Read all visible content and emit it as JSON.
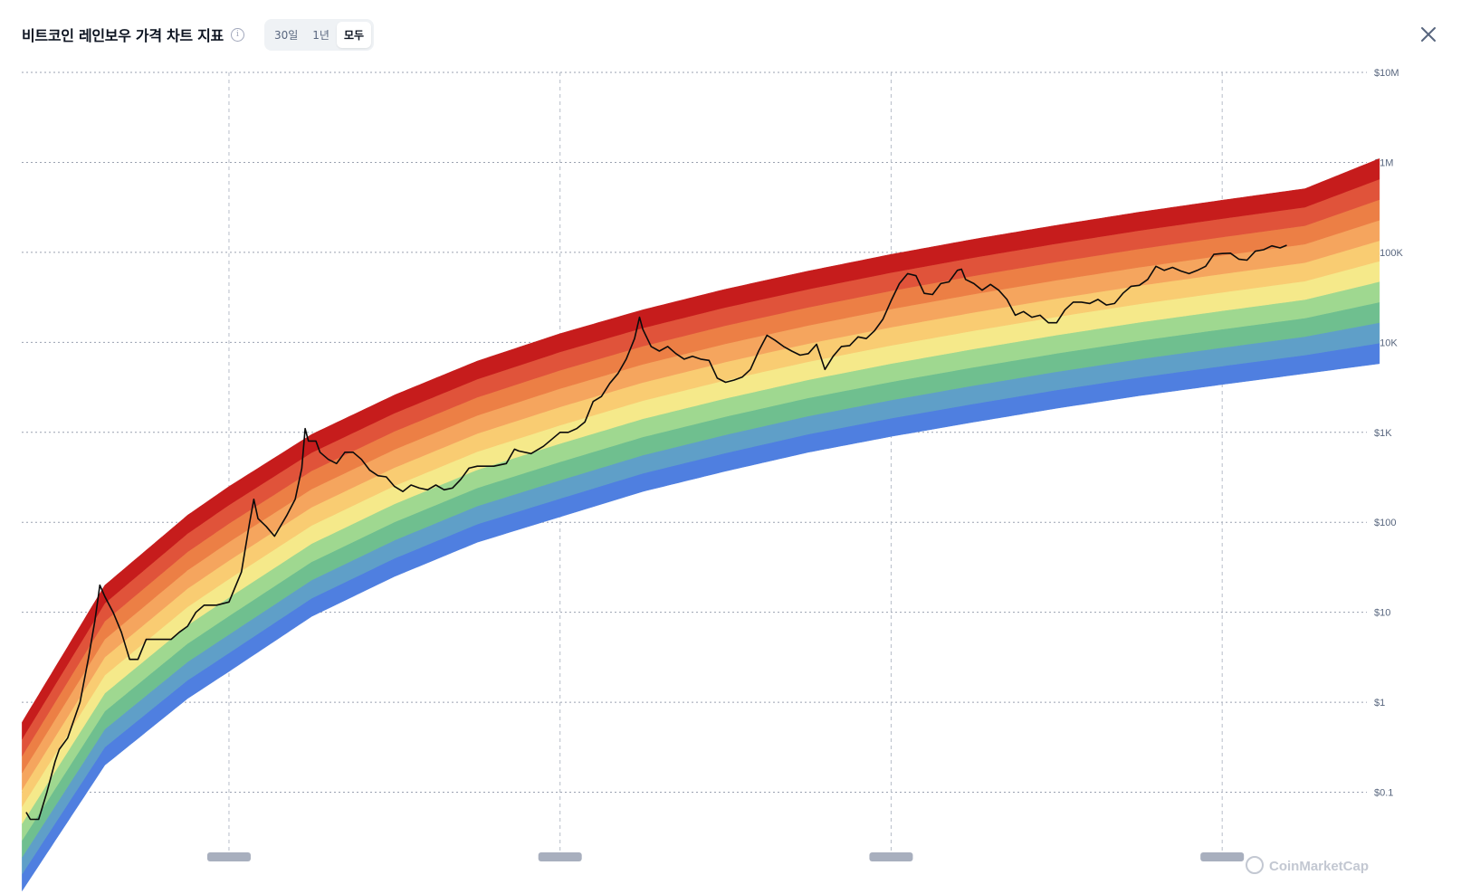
{
  "header": {
    "title": "비트코인 레인보우 가격 차트 지표",
    "info_icon": "info-icon",
    "ranges": [
      "30일",
      "1년",
      "모두"
    ],
    "active_range": "모두",
    "close_icon": "close-icon"
  },
  "watermark": "CoinMarketCap",
  "chart_data": {
    "type": "line",
    "y_scale": "log",
    "ylim": [
      0.01,
      10000000
    ],
    "xlim": [
      "2010-07-01",
      "2026-10-01"
    ],
    "y_ticks": [
      "$10M",
      "$1M",
      "$100K",
      "$10K",
      "$1K",
      "$100",
      "$10",
      "$1",
      "$0.1"
    ],
    "y_tick_values": [
      10000000,
      1000000,
      100000,
      10000,
      1000,
      100,
      10,
      1,
      0.1
    ],
    "x_grid_dates": [
      "2013-01-01",
      "2017-01-01",
      "2021-01-01",
      "2025-01-01"
    ],
    "grid": true,
    "legend": "none",
    "rainbow": {
      "colors": [
        "#4f7fe0",
        "#5f9fc8",
        "#6fbf8f",
        "#9fd890",
        "#f5e98a",
        "#f9cc72",
        "#f5a55e",
        "#ec7f45",
        "#e0533a",
        "#c61c1c"
      ],
      "bottom_band": [
        [
          2010.5,
          0.008
        ],
        [
          2011.5,
          0.2
        ],
        [
          2012.5,
          1.1
        ],
        [
          2013.0,
          2.2
        ],
        [
          2014.0,
          9
        ],
        [
          2015.0,
          25
        ],
        [
          2016.0,
          60
        ],
        [
          2017.0,
          115
        ],
        [
          2018.0,
          220
        ],
        [
          2019.0,
          370
        ],
        [
          2020.0,
          600
        ],
        [
          2021.0,
          900
        ],
        [
          2022.0,
          1300
        ],
        [
          2023.0,
          1850
        ],
        [
          2024.0,
          2550
        ],
        [
          2025.0,
          3400
        ],
        [
          2026.0,
          4500
        ],
        [
          2026.9,
          5800
        ]
      ],
      "top_band": [
        [
          2010.5,
          0.6
        ],
        [
          2011.5,
          20
        ],
        [
          2012.5,
          120
        ],
        [
          2013.0,
          250
        ],
        [
          2014.0,
          950
        ],
        [
          2015.0,
          2600
        ],
        [
          2016.0,
          6200
        ],
        [
          2017.0,
          12500
        ],
        [
          2018.0,
          23000
        ],
        [
          2019.0,
          39000
        ],
        [
          2020.0,
          62000
        ],
        [
          2021.0,
          95000
        ],
        [
          2022.0,
          140000
        ],
        [
          2023.0,
          200000
        ],
        [
          2024.0,
          280000
        ],
        [
          2025.0,
          380000
        ],
        [
          2026.0,
          510000
        ],
        [
          2026.9,
          1100000
        ]
      ]
    },
    "series": [
      {
        "values": [
          [
            2010.55,
            0.06
          ],
          [
            2010.6,
            0.05
          ],
          [
            2010.7,
            0.05
          ],
          [
            2010.8,
            0.1
          ],
          [
            2010.9,
            0.22
          ],
          [
            2010.95,
            0.3
          ],
          [
            2011.05,
            0.4
          ],
          [
            2011.2,
            1.0
          ],
          [
            2011.3,
            3
          ],
          [
            2011.38,
            8
          ],
          [
            2011.44,
            20
          ],
          [
            2011.5,
            15
          ],
          [
            2011.6,
            10
          ],
          [
            2011.7,
            6
          ],
          [
            2011.8,
            3
          ],
          [
            2011.9,
            3
          ],
          [
            2012.0,
            5
          ],
          [
            2012.1,
            5
          ],
          [
            2012.2,
            5
          ],
          [
            2012.3,
            5
          ],
          [
            2012.4,
            6
          ],
          [
            2012.5,
            7
          ],
          [
            2012.6,
            10
          ],
          [
            2012.7,
            12
          ],
          [
            2012.85,
            12
          ],
          [
            2013.0,
            13
          ],
          [
            2013.15,
            28
          ],
          [
            2013.25,
            100
          ],
          [
            2013.3,
            180
          ],
          [
            2013.35,
            110
          ],
          [
            2013.45,
            90
          ],
          [
            2013.55,
            70
          ],
          [
            2013.7,
            120
          ],
          [
            2013.8,
            180
          ],
          [
            2013.88,
            400
          ],
          [
            2013.92,
            1100
          ],
          [
            2013.96,
            800
          ],
          [
            2014.05,
            800
          ],
          [
            2014.1,
            600
          ],
          [
            2014.2,
            500
          ],
          [
            2014.3,
            450
          ],
          [
            2014.4,
            600
          ],
          [
            2014.5,
            600
          ],
          [
            2014.6,
            500
          ],
          [
            2014.7,
            380
          ],
          [
            2014.8,
            330
          ],
          [
            2014.9,
            320
          ],
          [
            2015.0,
            250
          ],
          [
            2015.1,
            220
          ],
          [
            2015.2,
            260
          ],
          [
            2015.3,
            240
          ],
          [
            2015.4,
            230
          ],
          [
            2015.5,
            260
          ],
          [
            2015.6,
            230
          ],
          [
            2015.7,
            240
          ],
          [
            2015.8,
            300
          ],
          [
            2015.9,
            400
          ],
          [
            2016.0,
            420
          ],
          [
            2016.2,
            420
          ],
          [
            2016.35,
            450
          ],
          [
            2016.45,
            650
          ],
          [
            2016.5,
            620
          ],
          [
            2016.65,
            580
          ],
          [
            2016.8,
            700
          ],
          [
            2017.0,
            1000
          ],
          [
            2017.1,
            1000
          ],
          [
            2017.2,
            1100
          ],
          [
            2017.3,
            1300
          ],
          [
            2017.4,
            2200
          ],
          [
            2017.5,
            2500
          ],
          [
            2017.6,
            3500
          ],
          [
            2017.7,
            4500
          ],
          [
            2017.8,
            6500
          ],
          [
            2017.9,
            11000
          ],
          [
            2017.96,
            19000
          ],
          [
            2018.0,
            14000
          ],
          [
            2018.1,
            9000
          ],
          [
            2018.2,
            8000
          ],
          [
            2018.3,
            9000
          ],
          [
            2018.4,
            7500
          ],
          [
            2018.5,
            6500
          ],
          [
            2018.6,
            7000
          ],
          [
            2018.7,
            6500
          ],
          [
            2018.8,
            6300
          ],
          [
            2018.9,
            4000
          ],
          [
            2019.0,
            3600
          ],
          [
            2019.1,
            3800
          ],
          [
            2019.2,
            4100
          ],
          [
            2019.3,
            5000
          ],
          [
            2019.4,
            8000
          ],
          [
            2019.5,
            12000
          ],
          [
            2019.6,
            10500
          ],
          [
            2019.7,
            9000
          ],
          [
            2019.8,
            8000
          ],
          [
            2019.9,
            7200
          ],
          [
            2020.0,
            7500
          ],
          [
            2020.1,
            9500
          ],
          [
            2020.2,
            5000
          ],
          [
            2020.3,
            7000
          ],
          [
            2020.4,
            9000
          ],
          [
            2020.5,
            9200
          ],
          [
            2020.6,
            11500
          ],
          [
            2020.7,
            11000
          ],
          [
            2020.8,
            13500
          ],
          [
            2020.9,
            18000
          ],
          [
            2021.0,
            29000
          ],
          [
            2021.1,
            45000
          ],
          [
            2021.2,
            58000
          ],
          [
            2021.3,
            55000
          ],
          [
            2021.4,
            35000
          ],
          [
            2021.5,
            34000
          ],
          [
            2021.6,
            45000
          ],
          [
            2021.7,
            47000
          ],
          [
            2021.8,
            63000
          ],
          [
            2021.85,
            65000
          ],
          [
            2021.9,
            50000
          ],
          [
            2022.0,
            45000
          ],
          [
            2022.1,
            38000
          ],
          [
            2022.2,
            44000
          ],
          [
            2022.3,
            38000
          ],
          [
            2022.4,
            30000
          ],
          [
            2022.5,
            20000
          ],
          [
            2022.6,
            22000
          ],
          [
            2022.7,
            19000
          ],
          [
            2022.8,
            20000
          ],
          [
            2022.9,
            16500
          ],
          [
            2023.0,
            16500
          ],
          [
            2023.1,
            23000
          ],
          [
            2023.2,
            28000
          ],
          [
            2023.3,
            28000
          ],
          [
            2023.4,
            27000
          ],
          [
            2023.5,
            30000
          ],
          [
            2023.6,
            26000
          ],
          [
            2023.7,
            27000
          ],
          [
            2023.8,
            35000
          ],
          [
            2023.9,
            42000
          ],
          [
            2024.0,
            43000
          ],
          [
            2024.1,
            50000
          ],
          [
            2024.2,
            70000
          ],
          [
            2024.3,
            63000
          ],
          [
            2024.4,
            68000
          ],
          [
            2024.5,
            62000
          ],
          [
            2024.6,
            58000
          ],
          [
            2024.7,
            63000
          ],
          [
            2024.8,
            70000
          ],
          [
            2024.9,
            95000
          ],
          [
            2025.0,
            97000
          ],
          [
            2025.1,
            98000
          ],
          [
            2025.2,
            84000
          ],
          [
            2025.3,
            82000
          ],
          [
            2025.4,
            103000
          ],
          [
            2025.5,
            107000
          ],
          [
            2025.6,
            118000
          ],
          [
            2025.7,
            112000
          ],
          [
            2025.78,
            120000
          ]
        ]
      }
    ]
  }
}
